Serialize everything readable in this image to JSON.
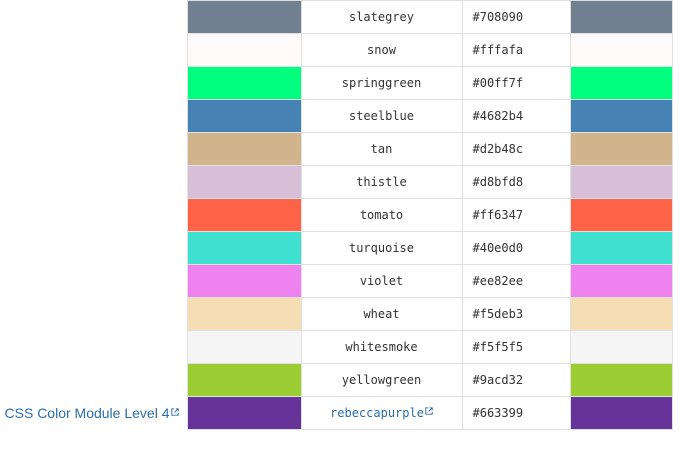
{
  "colors": [
    {
      "name": "slategrey",
      "hex": "#708090"
    },
    {
      "name": "snow",
      "hex": "#fffafa"
    },
    {
      "name": "springgreen",
      "hex": "#00ff7f"
    },
    {
      "name": "steelblue",
      "hex": "#4682b4"
    },
    {
      "name": "tan",
      "hex": "#d2b48c"
    },
    {
      "name": "thistle",
      "hex": "#d8bfd8"
    },
    {
      "name": "tomato",
      "hex": "#ff6347"
    },
    {
      "name": "turquoise",
      "hex": "#40e0d0"
    },
    {
      "name": "violet",
      "hex": "#ee82ee"
    },
    {
      "name": "wheat",
      "hex": "#f5deb3"
    },
    {
      "name": "whitesmoke",
      "hex": "#f5f5f5"
    },
    {
      "name": "yellowgreen",
      "hex": "#9acd32"
    },
    {
      "name": "rebeccapurple",
      "hex": "#663399",
      "spec": "CSS Color Module Level 4",
      "link": true
    }
  ],
  "icons": {
    "external": "external-link-icon"
  },
  "theme": {
    "link_color": "#2a6ea6",
    "border_color": "#e0e0e0"
  }
}
